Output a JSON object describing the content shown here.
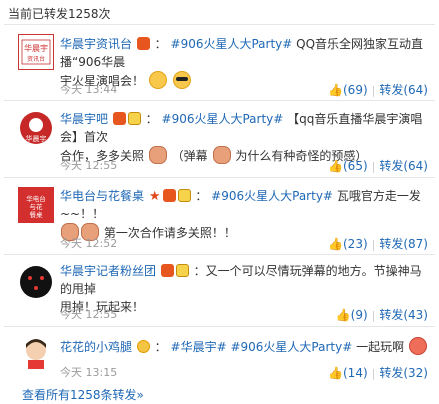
{
  "header": {
    "repost_count": "当前已转发1258次"
  },
  "posts": [
    {
      "user": "华晨宇资讯台",
      "avatar_text": "华晨宇资讯台",
      "topic": "#906火星人大Party#",
      "text_line1": "QQ音乐全网独家互动直播“906华晨",
      "text_line2": "宇火星演唱会！",
      "time": "今天 13:44",
      "likes": "(69)",
      "repost": "转发(64)"
    },
    {
      "user": "华晨宇吧",
      "avatar_text": "华晨宇",
      "topic": "#906火星人大Party#",
      "text_line1": "【qq音乐直播华晨宇演唱会】首次",
      "text_line2a": "合作，多多关照",
      "text_line2b": "（弹幕",
      "text_line2c": "为什么有种奇怪的预感）",
      "time": "今天 12:55",
      "likes": "(65)",
      "repost": "转发(64)"
    },
    {
      "user": "华电台与花餐桌",
      "avatar_text": "华电台与花餐桌",
      "topic": "#906火星人大Party#",
      "text_line1": "瓦哦官方走一发~~！！",
      "text_line2": "第一次合作请多关照！！",
      "time": "今天 12:52",
      "likes": "(23)",
      "repost": "转发(87)"
    },
    {
      "user": "华晨宇记者粉丝团",
      "topic": "",
      "text_line1": "：又一个可以尽情玩弹幕的地方。节操神马的甩掉",
      "text_line2": "甩掉！玩起来！",
      "time": "今天 12:55",
      "likes": "(9)",
      "repost": "转发(43)"
    },
    {
      "user": "花花的小鸡腿",
      "topic_a": "#华晨宇#",
      "topic_b": "#906火星人大Party#",
      "text_line1": "一起玩啊",
      "time": "今天 13:15",
      "likes": "(14)",
      "repost": "转发(32)"
    }
  ],
  "footer": {
    "view_all": "查看所有1258条转发»"
  },
  "colors": {
    "link": "#1f68b5",
    "meta": "#9b9b9b",
    "divider": "#e6e6e6"
  },
  "icons": [
    "v-badge-icon",
    "vip-icon",
    "tv-icon",
    "star-icon",
    "thumb-up-icon",
    "emoji-icon"
  ]
}
